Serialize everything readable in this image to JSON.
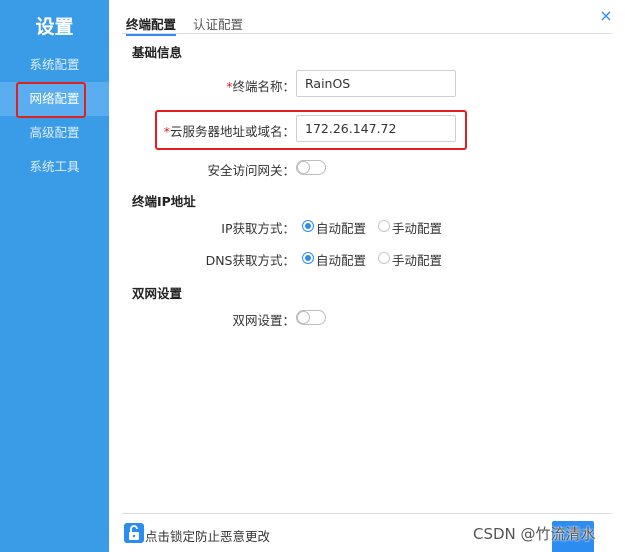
{
  "sidebar": {
    "title": "设置",
    "items": [
      {
        "label": "系统配置"
      },
      {
        "label": "网络配置"
      },
      {
        "label": "高级配置"
      },
      {
        "label": "系统工具"
      }
    ],
    "active_index": 1
  },
  "tabs": [
    {
      "label": "终端配置",
      "active": true
    },
    {
      "label": "认证配置",
      "active": false
    }
  ],
  "close_icon": "×",
  "basic_info": {
    "title": "基础信息",
    "terminal_name": {
      "required_mark": "*",
      "label": "终端名称：",
      "value": "RainOS"
    },
    "cloud_server": {
      "required_mark": "*",
      "label": "云服务器地址或域名：",
      "value": "172.26.147.72"
    },
    "secure_gateway": {
      "label": "安全访问网关：",
      "enabled": false
    }
  },
  "ip_section": {
    "title": "终端IP地址",
    "ip_mode": {
      "label": "IP获取方式：",
      "options": [
        "自动配置",
        "手动配置"
      ],
      "selected": "自动配置"
    },
    "dns_mode": {
      "label": "DNS获取方式：",
      "options": [
        "自动配置",
        "手动配置"
      ],
      "selected": "自动配置"
    }
  },
  "dual_network": {
    "title": "双网设置",
    "setting": {
      "label": "双网设置：",
      "enabled": false
    }
  },
  "footer": {
    "lock_text": "点击锁定防止恶意更改",
    "lock_icon": "unlock-icon"
  },
  "watermark": "CSDN @竹流清水",
  "colors": {
    "sidebar": "#3a9be6",
    "accent": "#2d8cf0",
    "highlight": "#e02020"
  }
}
